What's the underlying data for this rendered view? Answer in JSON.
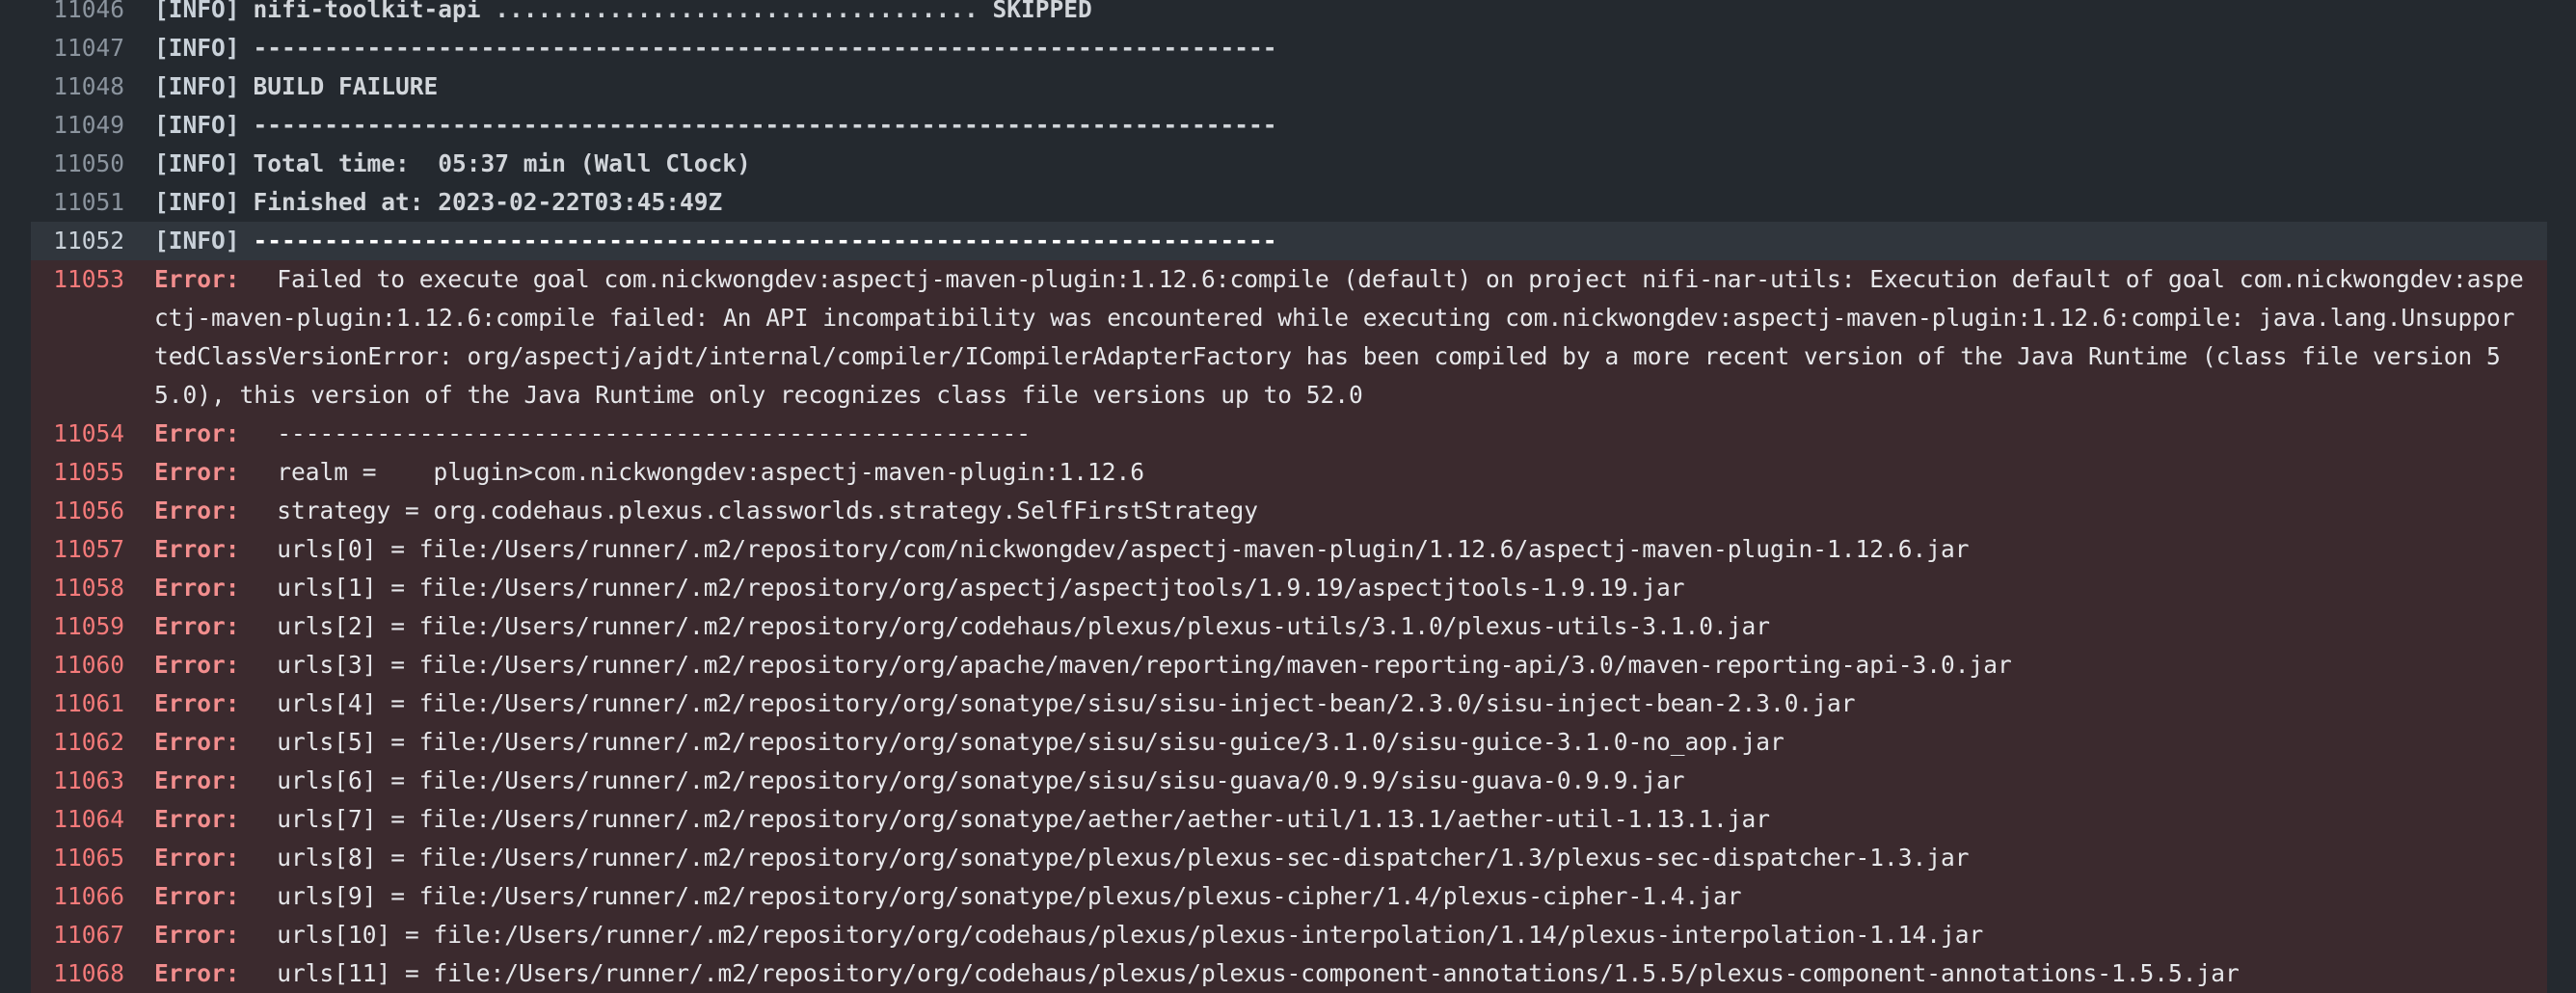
{
  "colors": {
    "background": "#24292f",
    "error_band": "#3b2a2e",
    "highlight_band": "#30363d",
    "error_text": "#f28e8e",
    "line_number": "#8b949e"
  },
  "log": {
    "lines": [
      {
        "num": "11046",
        "type": "info",
        "tag": "[INFO]",
        "msg": "nifi-toolkit-api .................................. SKIPPED"
      },
      {
        "num": "11047",
        "type": "info",
        "tag": "[INFO]",
        "msg": "------------------------------------------------------------------------"
      },
      {
        "num": "11048",
        "type": "info",
        "tag": "[INFO]",
        "msg": "BUILD FAILURE"
      },
      {
        "num": "11049",
        "type": "info",
        "tag": "[INFO]",
        "msg": "------------------------------------------------------------------------"
      },
      {
        "num": "11050",
        "type": "info",
        "tag": "[INFO]",
        "msg": "Total time:  05:37 min (Wall Clock)"
      },
      {
        "num": "11051",
        "type": "info",
        "tag": "[INFO]",
        "msg": "Finished at: 2023-02-22T03:45:49Z"
      },
      {
        "num": "11052",
        "type": "info highlight",
        "tag": "[INFO]",
        "msg": "------------------------------------------------------------------------"
      },
      {
        "num": "11053",
        "type": "error",
        "tag": "Error:",
        "msg": " Failed to execute goal com.nickwongdev:aspectj-maven-plugin:1.12.6:compile (default) on project nifi-nar-utils: Execution default of goal com.nickwongdev:aspectj-maven-plugin:1.12.6:compile failed: An API incompatibility was encountered while executing com.nickwongdev:aspectj-maven-plugin:1.12.6:compile: java.lang.UnsupportedClassVersionError: org/aspectj/ajdt/internal/compiler/ICompilerAdapterFactory has been compiled by a more recent version of the Java Runtime (class file version 55.0), this version of the Java Runtime only recognizes class file versions up to 52.0"
      },
      {
        "num": "11054",
        "type": "error",
        "tag": "Error:",
        "msg": " -----------------------------------------------------"
      },
      {
        "num": "11055",
        "type": "error",
        "tag": "Error:",
        "msg": " realm =    plugin>com.nickwongdev:aspectj-maven-plugin:1.12.6"
      },
      {
        "num": "11056",
        "type": "error",
        "tag": "Error:",
        "msg": " strategy = org.codehaus.plexus.classworlds.strategy.SelfFirstStrategy"
      },
      {
        "num": "11057",
        "type": "error",
        "tag": "Error:",
        "msg": " urls[0] = file:/Users/runner/.m2/repository/com/nickwongdev/aspectj-maven-plugin/1.12.6/aspectj-maven-plugin-1.12.6.jar"
      },
      {
        "num": "11058",
        "type": "error",
        "tag": "Error:",
        "msg": " urls[1] = file:/Users/runner/.m2/repository/org/aspectj/aspectjtools/1.9.19/aspectjtools-1.9.19.jar"
      },
      {
        "num": "11059",
        "type": "error",
        "tag": "Error:",
        "msg": " urls[2] = file:/Users/runner/.m2/repository/org/codehaus/plexus/plexus-utils/3.1.0/plexus-utils-3.1.0.jar"
      },
      {
        "num": "11060",
        "type": "error",
        "tag": "Error:",
        "msg": " urls[3] = file:/Users/runner/.m2/repository/org/apache/maven/reporting/maven-reporting-api/3.0/maven-reporting-api-3.0.jar"
      },
      {
        "num": "11061",
        "type": "error",
        "tag": "Error:",
        "msg": " urls[4] = file:/Users/runner/.m2/repository/org/sonatype/sisu/sisu-inject-bean/2.3.0/sisu-inject-bean-2.3.0.jar"
      },
      {
        "num": "11062",
        "type": "error",
        "tag": "Error:",
        "msg": " urls[5] = file:/Users/runner/.m2/repository/org/sonatype/sisu/sisu-guice/3.1.0/sisu-guice-3.1.0-no_aop.jar"
      },
      {
        "num": "11063",
        "type": "error",
        "tag": "Error:",
        "msg": " urls[6] = file:/Users/runner/.m2/repository/org/sonatype/sisu/sisu-guava/0.9.9/sisu-guava-0.9.9.jar"
      },
      {
        "num": "11064",
        "type": "error",
        "tag": "Error:",
        "msg": " urls[7] = file:/Users/runner/.m2/repository/org/sonatype/aether/aether-util/1.13.1/aether-util-1.13.1.jar"
      },
      {
        "num": "11065",
        "type": "error",
        "tag": "Error:",
        "msg": " urls[8] = file:/Users/runner/.m2/repository/org/sonatype/plexus/plexus-sec-dispatcher/1.3/plexus-sec-dispatcher-1.3.jar"
      },
      {
        "num": "11066",
        "type": "error",
        "tag": "Error:",
        "msg": " urls[9] = file:/Users/runner/.m2/repository/org/sonatype/plexus/plexus-cipher/1.4/plexus-cipher-1.4.jar"
      },
      {
        "num": "11067",
        "type": "error",
        "tag": "Error:",
        "msg": " urls[10] = file:/Users/runner/.m2/repository/org/codehaus/plexus/plexus-interpolation/1.14/plexus-interpolation-1.14.jar"
      },
      {
        "num": "11068",
        "type": "error",
        "tag": "Error:",
        "msg": " urls[11] = file:/Users/runner/.m2/repository/org/codehaus/plexus/plexus-component-annotations/1.5.5/plexus-component-annotations-1.5.5.jar"
      }
    ]
  }
}
